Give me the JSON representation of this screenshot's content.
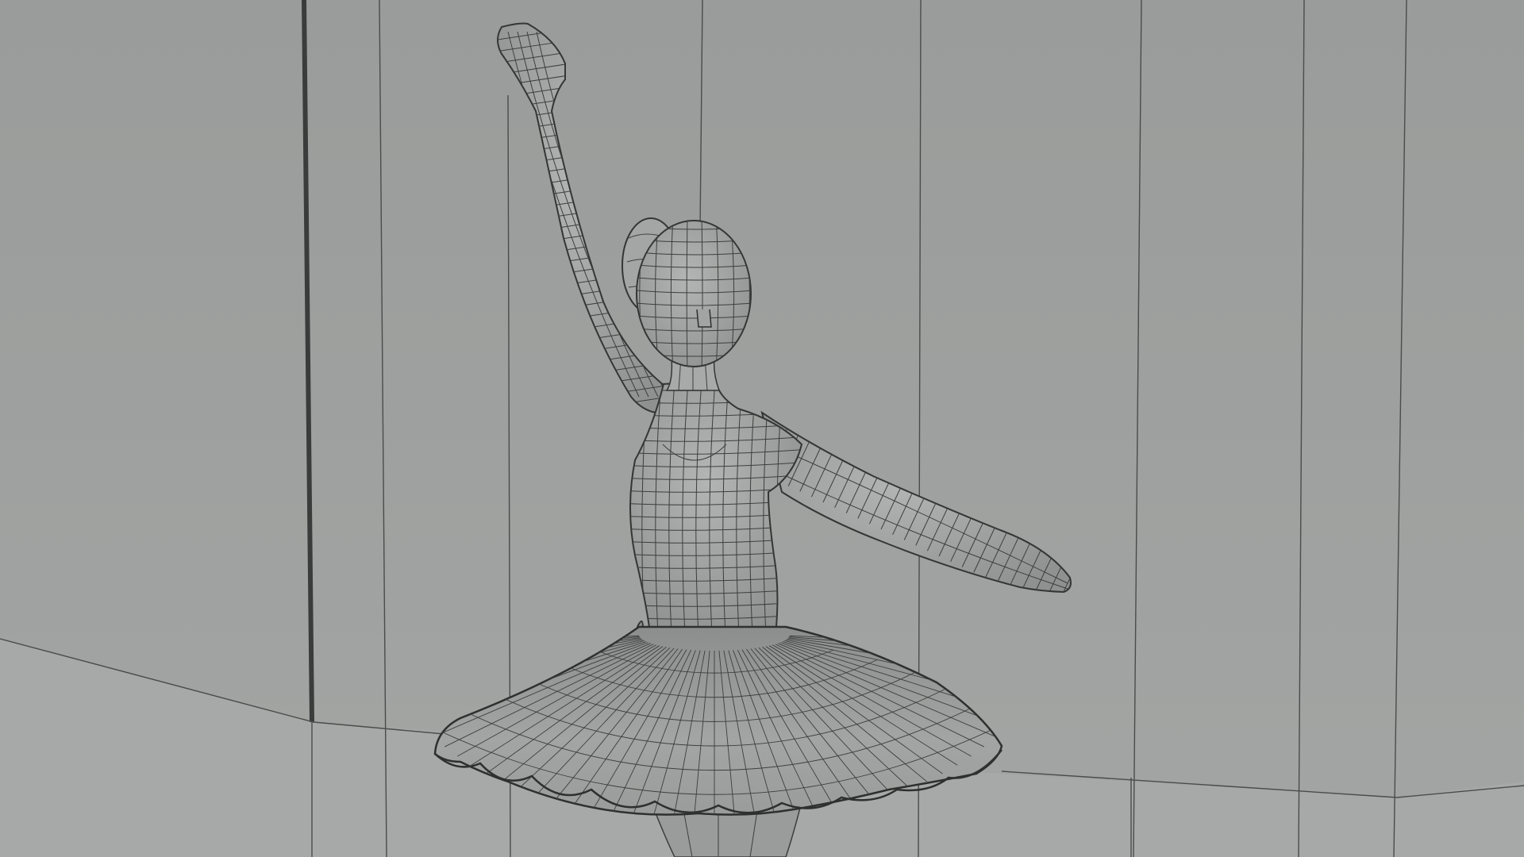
{
  "viewport": {
    "view_type": "3d-perspective",
    "shading": "wireframe-on-shaded",
    "background_color": "#9b9d9c",
    "wall_color": "#a2a4a3",
    "floor_color": "#a6a8a7",
    "model_fill_color": "#9ea09f",
    "wire_color": "#3c3e3d",
    "scene_objects": [
      "room-walls",
      "floor",
      "ballerina-figure"
    ],
    "figure_parts": [
      "head",
      "hair-bun",
      "neck",
      "torso",
      "raised-right-arm",
      "extended-left-arm",
      "waistband",
      "tutu-skirt",
      "legs"
    ]
  }
}
